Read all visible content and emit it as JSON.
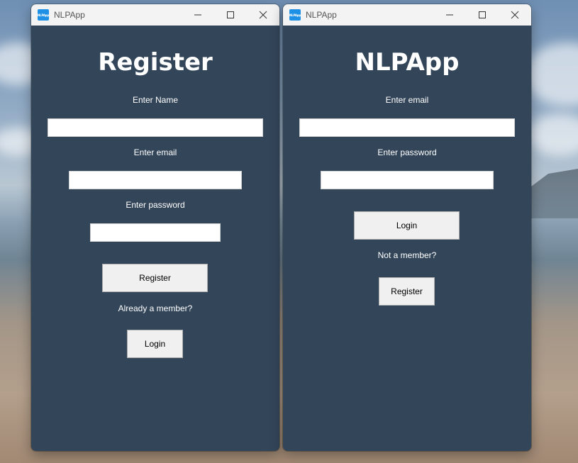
{
  "windows": {
    "register": {
      "title": "NLPApp",
      "icon_text": "NLPApp",
      "heading": "Register",
      "name_label": "Enter Name",
      "name_value": "",
      "email_label": "Enter email",
      "email_value": "",
      "password_label": "Enter password",
      "password_value": "",
      "register_button": "Register",
      "member_prompt": "Already a member?",
      "login_button": "Login"
    },
    "login": {
      "title": "NLPApp",
      "icon_text": "NLPApp",
      "heading": "NLPApp",
      "email_label": "Enter email",
      "email_value": "",
      "password_label": "Enter password",
      "password_value": "",
      "login_button": "Login",
      "member_prompt": "Not a member?",
      "register_button": "Register"
    }
  },
  "colors": {
    "window_background": "#334559",
    "titlebar_background": "#f3f3f3",
    "app_icon": "#1e90e6",
    "button_background": "#f0f0f0"
  },
  "icons": {
    "minimize": "minimize-icon",
    "maximize": "maximize-icon",
    "close": "close-icon"
  }
}
